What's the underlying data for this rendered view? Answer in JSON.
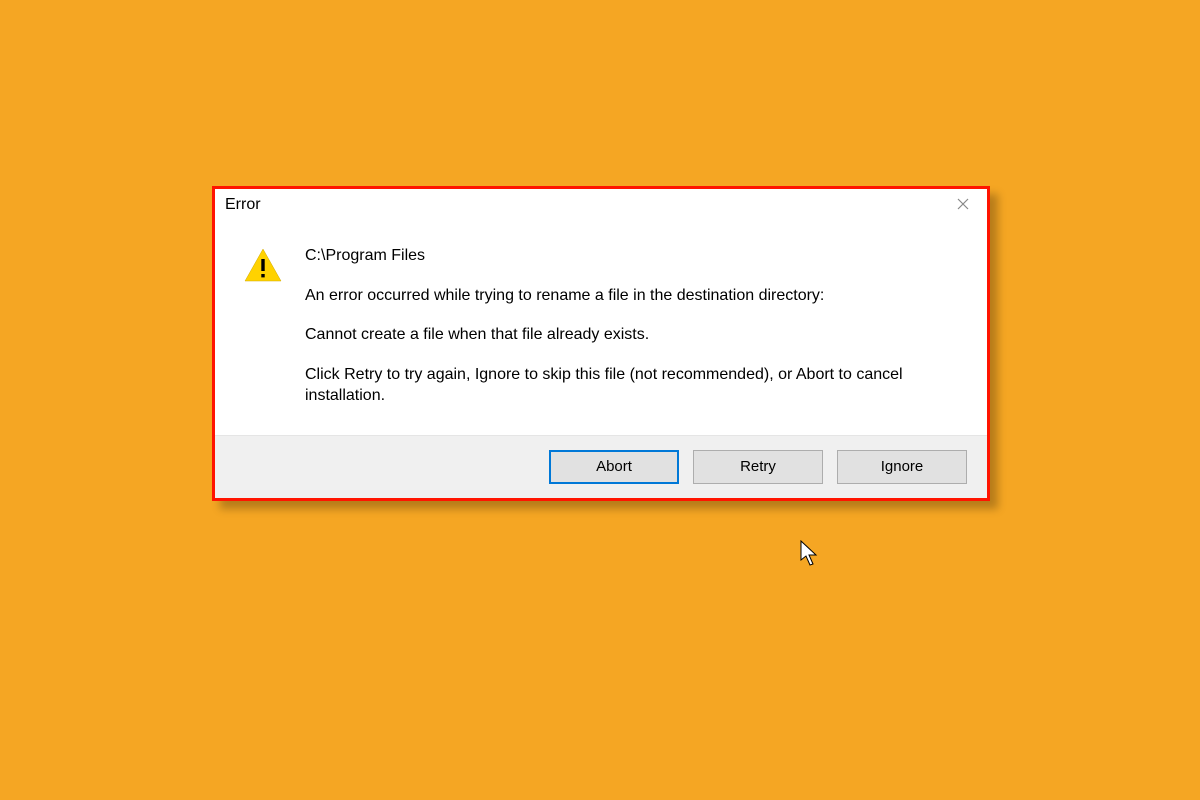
{
  "dialog": {
    "title": "Error",
    "path": "C:\\Program Files",
    "message_line1": "An error occurred while trying to rename a file in the destination directory:",
    "message_line2": "Cannot create a file when that file already exists.",
    "message_line3": "Click Retry to try again, Ignore to skip this file (not recommended), or Abort to cancel installation.",
    "buttons": {
      "abort": "Abort",
      "retry": "Retry",
      "ignore": "Ignore"
    }
  }
}
